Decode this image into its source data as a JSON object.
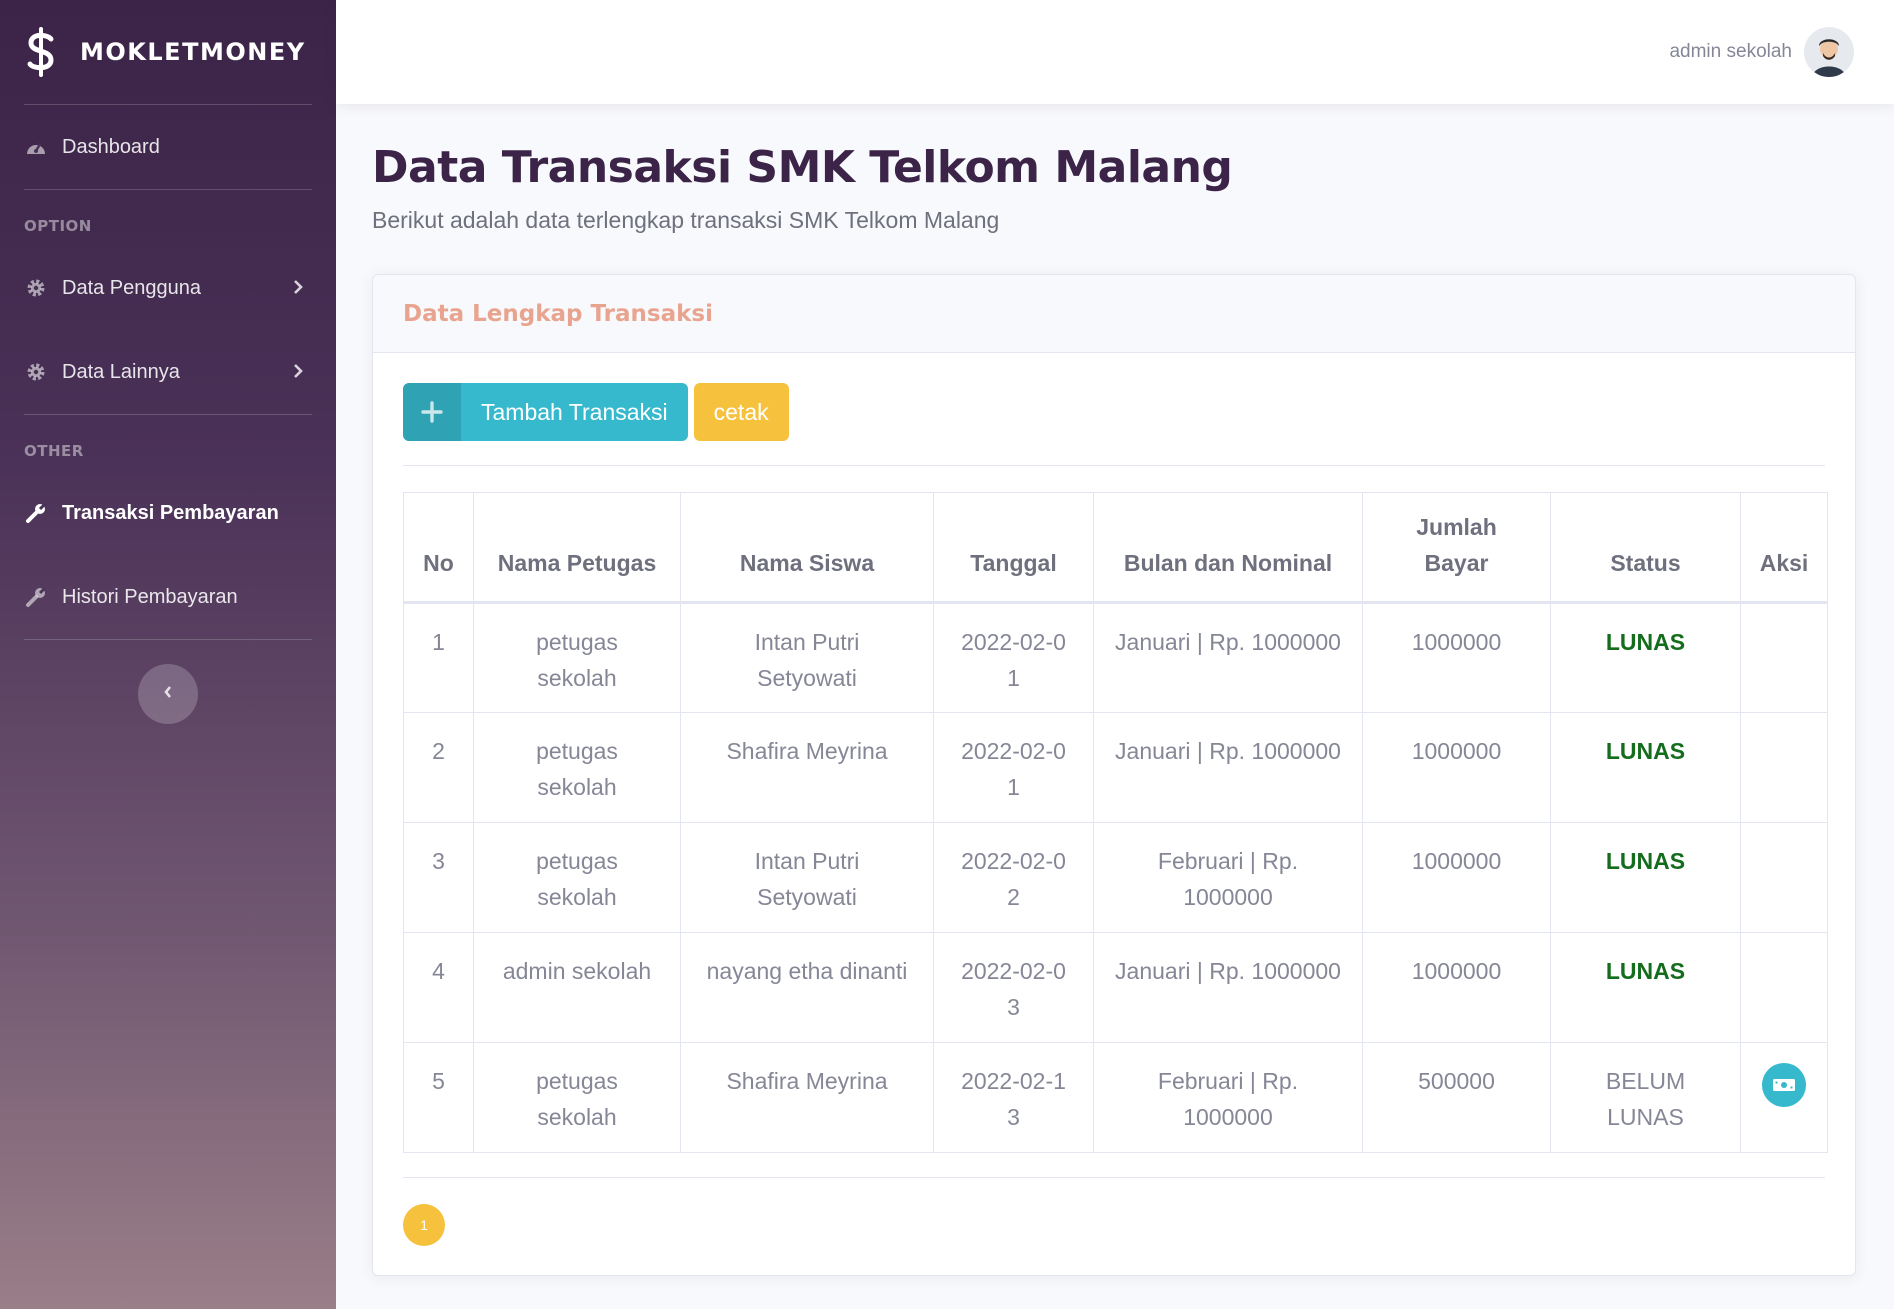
{
  "brand": {
    "name": "MOKLETMONEY",
    "icon": "dollar-icon"
  },
  "sidebar": {
    "dashboard": {
      "label": "Dashboard",
      "icon": "tachometer-icon"
    },
    "heading_option": "OPTION",
    "data_pengguna": {
      "label": "Data Pengguna",
      "icon": "gear-icon"
    },
    "data_lainnya": {
      "label": "Data Lainnya",
      "icon": "gear-icon"
    },
    "heading_other": "OTHER",
    "transaksi": {
      "label": "Transaksi Pembayaran",
      "icon": "wrench-icon"
    },
    "histori": {
      "label": "Histori Pembayaran",
      "icon": "wrench-icon"
    }
  },
  "topbar": {
    "user_name": "admin sekolah"
  },
  "page": {
    "title": "Data Transaksi SMK Telkom Malang",
    "subtitle": "Berikut adalah data terlengkap transaksi SMK Telkom Malang"
  },
  "card": {
    "title": "Data Lengkap Transaksi",
    "add_button": "Tambah Transaksi",
    "print_button": "cetak"
  },
  "table": {
    "headers": [
      "No",
      "Nama Petugas",
      "Nama Siswa",
      "Tanggal",
      "Bulan dan Nominal",
      "Jumlah Bayar",
      "Status",
      "Aksi"
    ],
    "rows": [
      {
        "no": "1",
        "petugas": "petugas sekolah",
        "siswa": "Intan Putri Setyowati",
        "tanggal": "2022-02-01",
        "bulan": "Januari | Rp. 1000000",
        "jumlah": "1000000",
        "status": "LUNAS"
      },
      {
        "no": "2",
        "petugas": "petugas sekolah",
        "siswa": "Shafira Meyrina",
        "tanggal": "2022-02-01",
        "bulan": "Januari | Rp. 1000000",
        "jumlah": "1000000",
        "status": "LUNAS"
      },
      {
        "no": "3",
        "petugas": "petugas sekolah",
        "siswa": "Intan Putri Setyowati",
        "tanggal": "2022-02-02",
        "bulan": "Februari | Rp. 1000000",
        "jumlah": "1000000",
        "status": "LUNAS"
      },
      {
        "no": "4",
        "petugas": "admin sekolah",
        "siswa": "nayang etha dinanti",
        "tanggal": "2022-02-03",
        "bulan": "Januari | Rp. 1000000",
        "jumlah": "1000000",
        "status": "LUNAS"
      },
      {
        "no": "5",
        "petugas": "petugas sekolah",
        "siswa": "Shafira Meyrina",
        "tanggal": "2022-02-13",
        "bulan": "Februari | Rp. 1000000",
        "jumlah": "500000",
        "status": "BELUM LUNAS",
        "action_icon": "money-bill-icon"
      }
    ]
  },
  "pagination": {
    "current": "1"
  },
  "colors": {
    "accent": "#36b9cc",
    "warning": "#f6c23e",
    "lunas": "#146c1d",
    "title": "#3b2447"
  }
}
